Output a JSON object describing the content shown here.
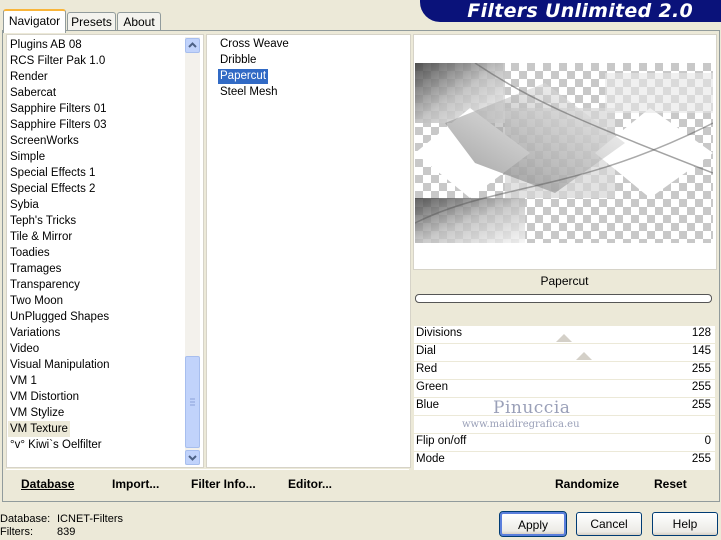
{
  "tabs": [
    "Navigator",
    "Presets",
    "About"
  ],
  "banner_title": "Filters Unlimited 2.0",
  "categories": [
    "Plugins AB 08",
    "RCS Filter Pak 1.0",
    "Render",
    "Sabercat",
    "Sapphire Filters 01",
    "Sapphire Filters 03",
    "ScreenWorks",
    "Simple",
    "Special Effects 1",
    "Special Effects 2",
    "Sybia",
    "Teph's Tricks",
    "Tile & Mirror",
    "Toadies",
    "Tramages",
    "Transparency",
    "Two Moon",
    "UnPlugged Shapes",
    "Variations",
    "Video",
    "Visual Manipulation",
    "VM 1",
    "VM Distortion",
    "VM Stylize",
    "VM Texture",
    "°v° Kiwi`s Oelfilter"
  ],
  "selected_category": "VM Texture",
  "filters": [
    "Cross Weave",
    "Dribble",
    "Papercut",
    "Steel Mesh"
  ],
  "selected_filter": "Papercut",
  "preview_filter_name": "Papercut",
  "params": [
    {
      "label": "Divisions",
      "value": "128"
    },
    {
      "label": "Dial",
      "value": "145"
    },
    {
      "label": "Red",
      "value": "255"
    },
    {
      "label": "Green",
      "value": "255"
    },
    {
      "label": "Blue",
      "value": "255"
    },
    {
      "label": "",
      "value": ""
    },
    {
      "label": "Flip on/off",
      "value": "0"
    },
    {
      "label": "Mode",
      "value": "255"
    }
  ],
  "watermark": {
    "line1": "Pinuccia",
    "line2": "www.maidiregrafica.eu"
  },
  "footer_buttons": {
    "database": "Database",
    "import": "Import...",
    "filter_info": "Filter Info...",
    "editor": "Editor...",
    "randomize": "Randomize",
    "reset": "Reset"
  },
  "status": {
    "database_label": "Database:",
    "database_value": "ICNET-Filters",
    "filters_label": "Filters:",
    "filters_value": "839"
  },
  "dialog_buttons": {
    "apply": "Apply",
    "cancel": "Cancel",
    "help": "Help"
  },
  "icons": {
    "scroll_up": "chevron-up-icon",
    "scroll_down": "chevron-down-icon",
    "scroll_thumb": "grip-icon"
  },
  "colors": {
    "banner": "#0A127A",
    "selection": "#316AC5",
    "face": "#ECE9D8",
    "tab_accent": "#F9B53A"
  }
}
